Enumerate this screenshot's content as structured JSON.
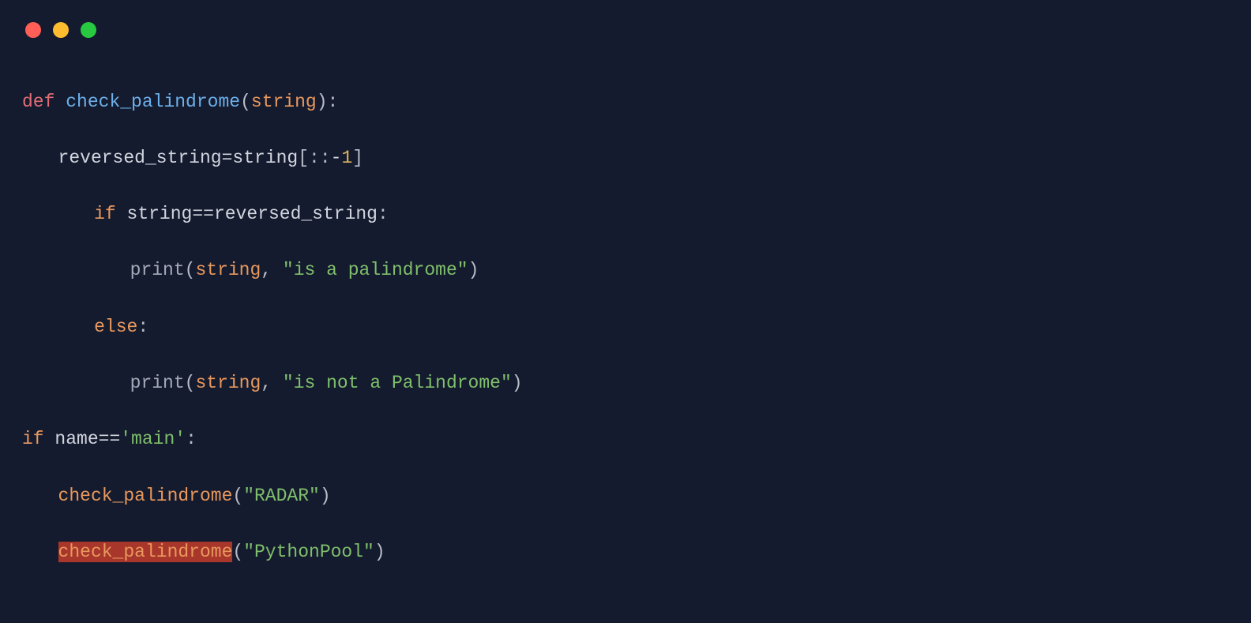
{
  "code": {
    "line1": {
      "def": "def",
      "fn": "check_palindrome",
      "lp": "(",
      "param": "string",
      "rp": ")",
      "colon": ":"
    },
    "line2": {
      "lhs": "reversed_string",
      "eq": "=",
      "rhs": "string",
      "lb": "[",
      "c1": ":",
      "c2": ":",
      "neg": "-",
      "one": "1",
      "rb": "]"
    },
    "line3": {
      "if": "if",
      "lhs": "string",
      "eq": "==",
      "rhs": "reversed_string",
      "colon": ":"
    },
    "line4": {
      "print": "print",
      "lp": "(",
      "arg1": "string",
      "comma": ",",
      "str": "\"is a palindrome\"",
      "rp": ")"
    },
    "line5": {
      "else": "else",
      "colon": ":"
    },
    "line6": {
      "print": "print",
      "lp": "(",
      "arg1": "string",
      "comma": ",",
      "str": "\"is not a Palindrome\"",
      "rp": ")"
    },
    "line7": {
      "if": "if",
      "lhs": "name",
      "eq": "==",
      "str": "'main'",
      "colon": ":"
    },
    "line8": {
      "fn": "check_palindrome",
      "lp": "(",
      "str": "\"RADAR\"",
      "rp": ")"
    },
    "line9": {
      "fn": "check_palindrome",
      "lp": "(",
      "str": "\"PythonPool\"",
      "rp": ")"
    }
  }
}
